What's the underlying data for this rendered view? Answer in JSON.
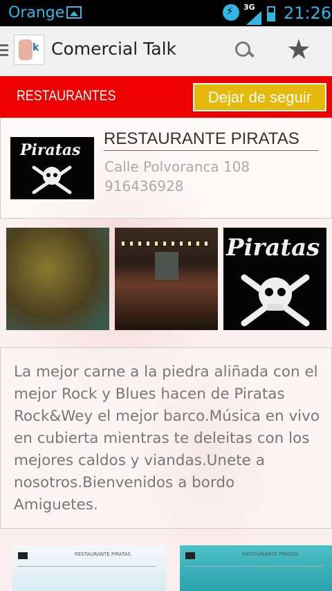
{
  "status_bar": {
    "carrier": "Orange",
    "network": "3G",
    "time": "21:26"
  },
  "action_bar": {
    "app_title": "Comercial Talk",
    "logo_text": "k"
  },
  "category_bar": {
    "label": "RESTAURANTES",
    "unfollow_label": "Dejar de seguir",
    "bar_color": "#ee0000",
    "button_color": "#e4b90b"
  },
  "place": {
    "name": "RESTAURANTE PIRATAS",
    "address": "Calle Polvoranca 108",
    "phone": "916436928",
    "logo_word": "Piratas"
  },
  "gallery": {
    "images": [
      "photo-treasure",
      "photo-interior",
      "photo-pirates-logo"
    ],
    "logo_word": "Piratas"
  },
  "description": "La mejor carne a la piedra aliñada con el mejor Rock y Blues hacen de Piratas Rock&Wey el mejor barco.Música en vivo en cubierta mientras te deleitas con los mejores caldos y viandas.Unete a nosotros.Bienvenidos a bordo Amiguetes.",
  "related": [
    {
      "title": "RESTAURANTE PIRATAS"
    },
    {
      "title": "RESTAURANTE PIRATAS"
    }
  ]
}
